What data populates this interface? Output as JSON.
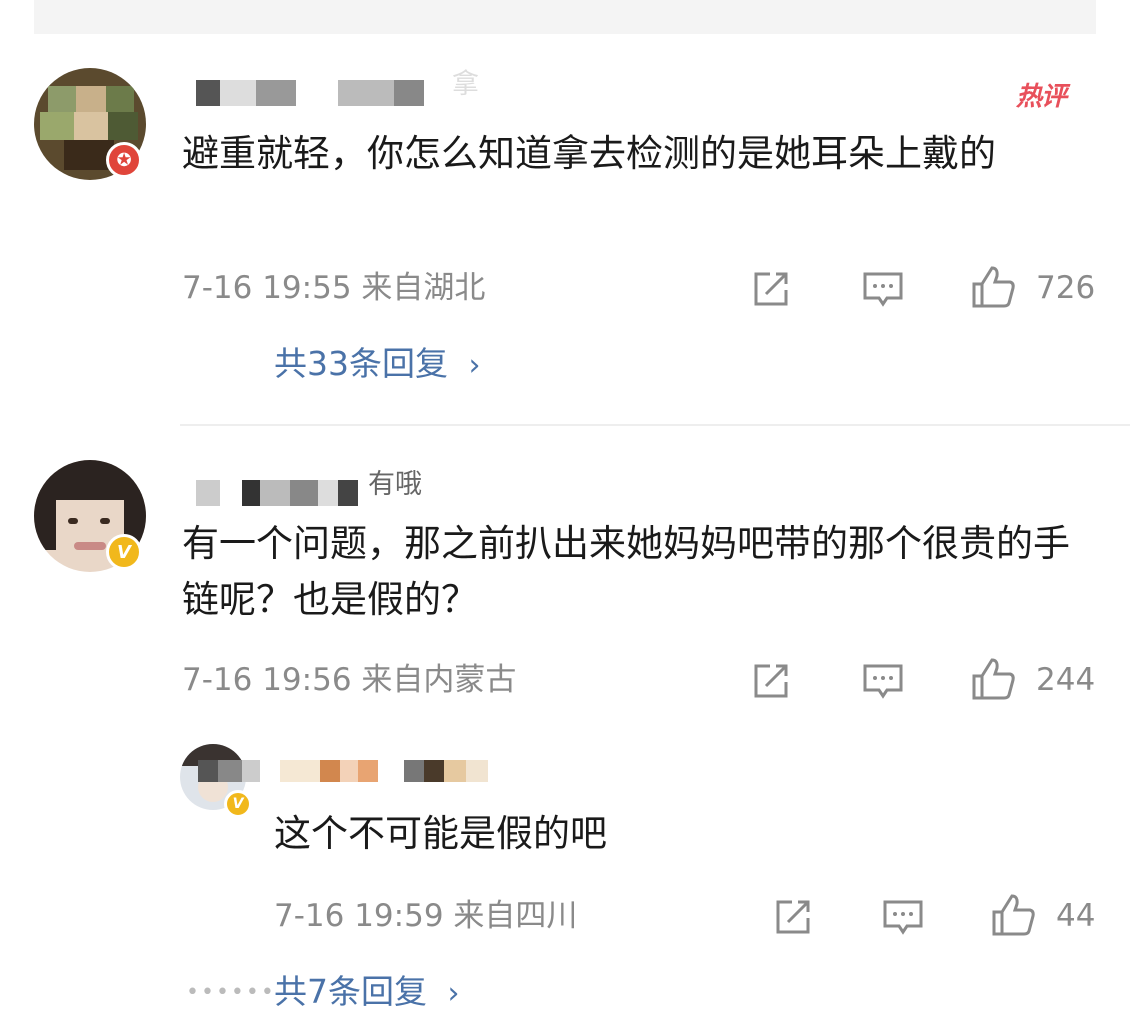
{
  "comments": [
    {
      "username_tail": "拿",
      "hot_label": "热评",
      "text": "避重就轻，你怎么知道拿去检测的是她耳朵上戴的",
      "time": "7-16 19:55",
      "location": "来自湖北",
      "likes": "726",
      "replies_label": "共33条回复"
    },
    {
      "username_tail": "有哦",
      "text": "有一个问题，那之前扒出来她妈妈吧带的那个很贵的手链呢？也是假的？",
      "time": "7-16 19:56",
      "location": "来自内蒙古",
      "likes": "244",
      "reply": {
        "text": "这个不可能是假的吧",
        "time": "7-16 19:59",
        "location": "来自四川",
        "likes": "44"
      },
      "replies_label": "共7条回复"
    }
  ],
  "icons": {
    "share": "share-icon",
    "comment": "comment-icon",
    "like": "thumbs-up-icon",
    "chevron": "chevron-right-icon"
  },
  "colors": {
    "link": "#4a72a8",
    "hot": "#e8505b",
    "meta": "#8a8a8a"
  }
}
